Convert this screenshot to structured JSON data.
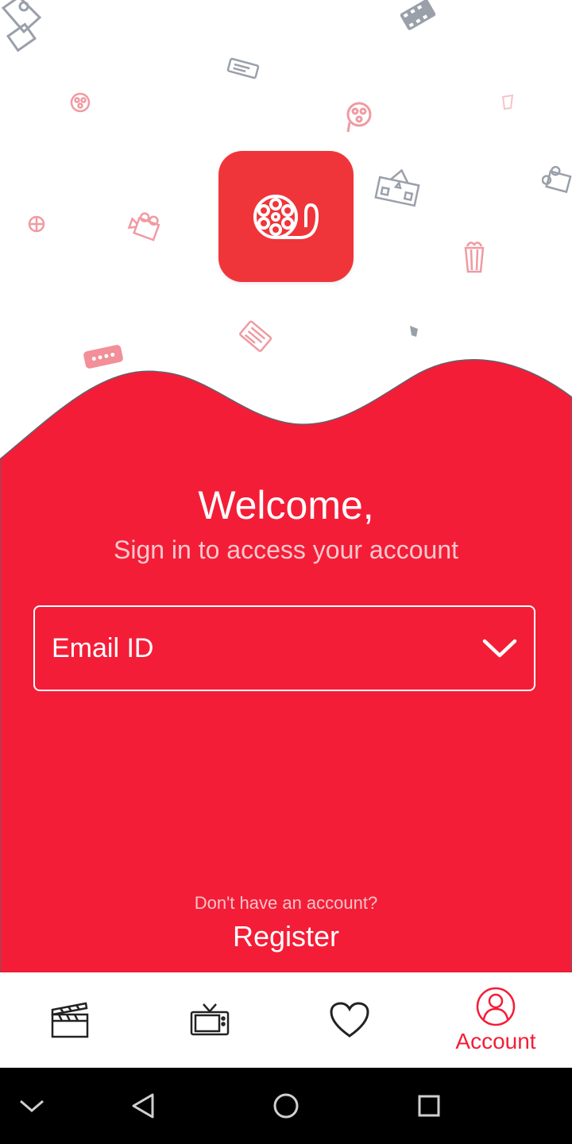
{
  "colors": {
    "brand_red": "#f41d37",
    "logo_red": "#f0353a"
  },
  "logo": {
    "icon": "film-reel-icon"
  },
  "welcome": {
    "title": "Welcome,",
    "subtitle": "Sign in to access your account"
  },
  "email_select": {
    "label": "Email ID",
    "icon": "chevron-down-icon"
  },
  "register": {
    "prompt": "Don't have an account?",
    "link": "Register"
  },
  "bottom_nav": {
    "items": [
      {
        "id": "movies",
        "icon": "clapperboard-icon",
        "label": ""
      },
      {
        "id": "tv",
        "icon": "tv-icon",
        "label": ""
      },
      {
        "id": "favorites",
        "icon": "heart-icon",
        "label": ""
      },
      {
        "id": "account",
        "icon": "user-icon",
        "label": "Account",
        "active": true
      }
    ]
  },
  "system_nav": [
    "collapse-icon",
    "back-icon",
    "home-icon",
    "recents-icon"
  ]
}
